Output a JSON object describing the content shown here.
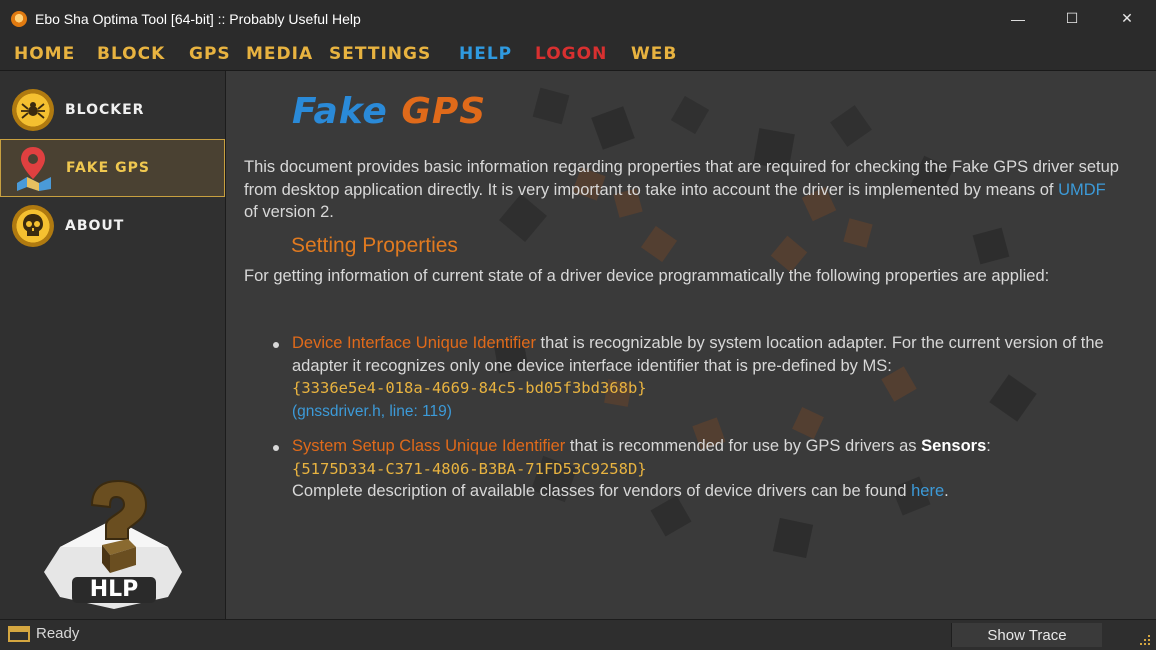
{
  "window": {
    "title": "Ebo Sha Optima Tool [64-bit] :: Probably Useful Help",
    "minimize": "—",
    "maximize": "☐",
    "close": "✕"
  },
  "menu": {
    "items": [
      "HOME",
      "BLOCK",
      "GPS",
      "MEDIA",
      "SETTINGS",
      "HELP",
      "LOGON",
      "WEB"
    ],
    "active": "HELP",
    "colors": {
      "default": "#e8b340",
      "active": "#2f9ae0",
      "logon": "#d83030"
    }
  },
  "sidebar": {
    "items": [
      {
        "label": "BLOCKER",
        "icon": "spider-icon"
      },
      {
        "label": "FAKE GPS",
        "icon": "map-pin-icon",
        "active": true
      },
      {
        "label": "ABOUT",
        "icon": "skull-icon"
      }
    ],
    "logo_text": "HLP"
  },
  "document": {
    "title_part1": "Fake",
    "title_part2": "GPS",
    "intro": "This document provides basic information regarding properties that are required for checking the Fake GPS driver setup from desktop application directly. It is very important to take into account the driver is implemented by means of ",
    "intro_link": "UMDF",
    "intro_end": " of version 2.",
    "section_title": "Setting Properties",
    "section_intro": "For getting information of current state of a driver device programmatically the following properties are applied:",
    "bullet1": {
      "term": "Device Interface Unique Identifier",
      "text": " that is recognizable by system location adapter. For the current version of the adapter it recognizes only one device interface identifier that is pre-defined by MS:",
      "guid": "{3336e5e4-018a-4669-84c5-bd05f3bd368b}",
      "ref": "(gnssdriver.h, line: 119)"
    },
    "bullet2": {
      "term": "System Setup Class Unique Identifier",
      "text": " that is recommended for use by GPS drivers as ",
      "bold": "Sensors",
      "colon": ":",
      "guid": "{5175D334-C371-4806-B3BA-71FD53C9258D}",
      "desc": "Complete description of available classes for vendors of device drivers can be found ",
      "link": "here",
      "period": "."
    }
  },
  "status": {
    "text": "Ready",
    "trace_button": "Show Trace"
  }
}
